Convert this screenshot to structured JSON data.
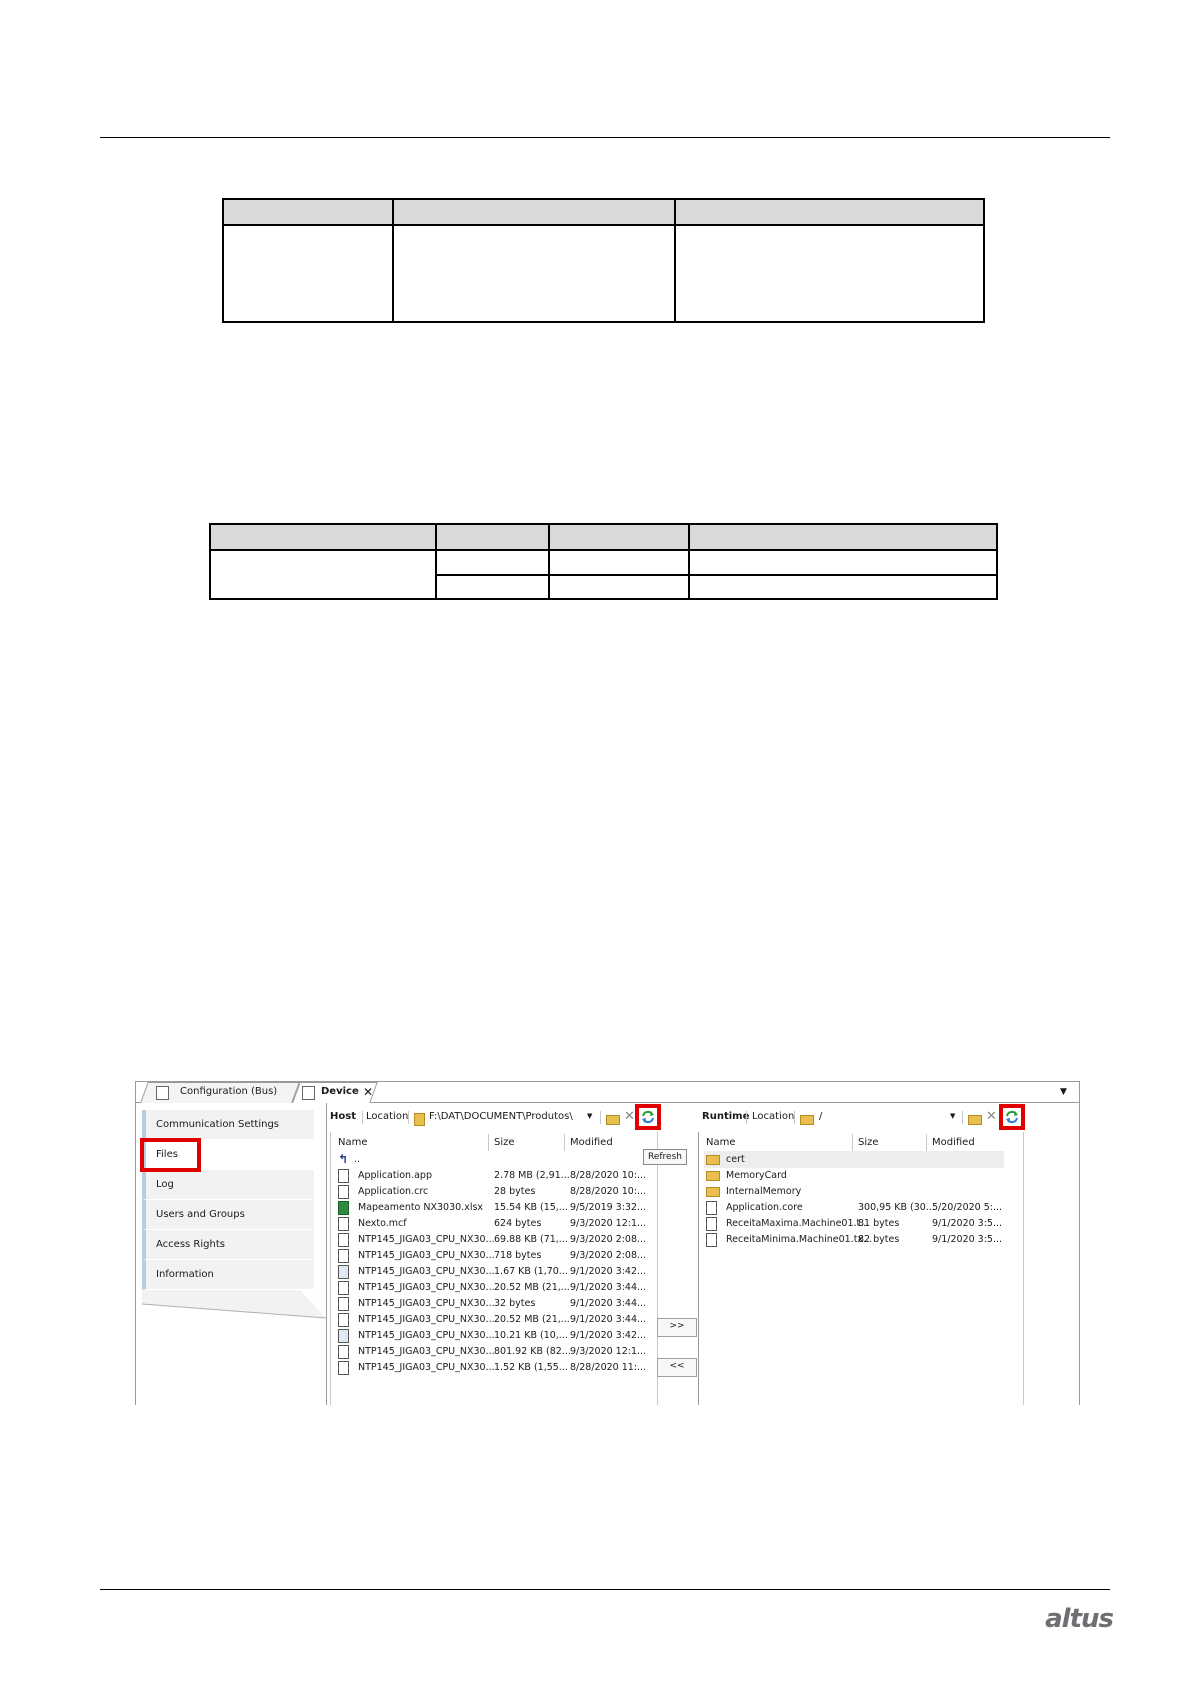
{
  "tabs": [
    {
      "label": "Configuration (Bus)",
      "active": false
    },
    {
      "label": "Device",
      "active": true
    }
  ],
  "sidebar": {
    "items": [
      {
        "label": "Communication Settings"
      },
      {
        "label": "Files",
        "selected": true
      },
      {
        "label": "Log"
      },
      {
        "label": "Users and Groups"
      },
      {
        "label": "Access Rights"
      },
      {
        "label": "Information"
      }
    ]
  },
  "host": {
    "title": "Host",
    "location_label": "Location",
    "path": "F:\\DAT\\DOCUMENT\\Produtos\\",
    "columns": [
      "Name",
      "Size",
      "Modified"
    ],
    "up_label": "..",
    "files": [
      {
        "name": "Application.app",
        "size": "2.78 MB (2,91...",
        "modified": "8/28/2020 10:...",
        "icon": "file"
      },
      {
        "name": "Application.crc",
        "size": "28 bytes",
        "modified": "8/28/2020 10:...",
        "icon": "file"
      },
      {
        "name": "Mapeamento NX3030.xlsx",
        "size": "15.54 KB (15,...",
        "modified": "9/5/2019 3:32...",
        "icon": "excel"
      },
      {
        "name": "Nexto.mcf",
        "size": "624 bytes",
        "modified": "9/3/2020 12:1...",
        "icon": "file"
      },
      {
        "name": "NTP145_JIGA03_CPU_NX30...",
        "size": "69.88 KB (71,...",
        "modified": "9/3/2020 2:08...",
        "icon": "file"
      },
      {
        "name": "NTP145_JIGA03_CPU_NX30...",
        "size": "718 bytes",
        "modified": "9/3/2020 2:08...",
        "icon": "file"
      },
      {
        "name": "NTP145_JIGA03_CPU_NX30...",
        "size": "1.67 KB (1,70...",
        "modified": "9/1/2020 3:42...",
        "icon": "doc"
      },
      {
        "name": "NTP145_JIGA03_CPU_NX30...",
        "size": "20.52 MB (21,...",
        "modified": "9/1/2020 3:44...",
        "icon": "file"
      },
      {
        "name": "NTP145_JIGA03_CPU_NX30...",
        "size": "32 bytes",
        "modified": "9/1/2020 3:44...",
        "icon": "file"
      },
      {
        "name": "NTP145_JIGA03_CPU_NX30...",
        "size": "20.52 MB (21,...",
        "modified": "9/1/2020 3:44...",
        "icon": "file"
      },
      {
        "name": "NTP145_JIGA03_CPU_NX30...",
        "size": "10.21 KB (10,...",
        "modified": "9/1/2020 3:42...",
        "icon": "doc"
      },
      {
        "name": "NTP145_JIGA03_CPU_NX30...",
        "size": "801.92 KB (82...",
        "modified": "9/3/2020 12:1...",
        "icon": "file"
      },
      {
        "name": "NTP145_JIGA03_CPU_NX30...",
        "size": "1.52 KB (1,55...",
        "modified": "8/28/2020 11:...",
        "icon": "file"
      }
    ]
  },
  "tooltip": "Refresh",
  "transfer": {
    "to_runtime": ">>",
    "to_host": "<<"
  },
  "runtime": {
    "title": "Runtime",
    "location_label": "Location",
    "path": "/",
    "columns": [
      "Name",
      "Size",
      "Modified"
    ],
    "files": [
      {
        "name": "cert",
        "size": "",
        "modified": "",
        "icon": "folder"
      },
      {
        "name": "MemoryCard",
        "size": "",
        "modified": "",
        "icon": "folder"
      },
      {
        "name": "InternalMemory",
        "size": "",
        "modified": "",
        "icon": "folder"
      },
      {
        "name": "Application.core",
        "size": "300,95 KB (30...",
        "modified": "5/20/2020 5:...",
        "icon": "file"
      },
      {
        "name": "ReceitaMaxima.Machine01.t...",
        "size": "81 bytes",
        "modified": "9/1/2020 3:5...",
        "icon": "file"
      },
      {
        "name": "ReceitaMinima.Machine01.tx...",
        "size": "82 bytes",
        "modified": "9/1/2020 3:5...",
        "icon": "file"
      }
    ]
  },
  "brand": {
    "logo": "altus"
  },
  "colors": {
    "highlight": "#e00000",
    "accent": "#b9cbe3",
    "folder": "#e8c050"
  }
}
